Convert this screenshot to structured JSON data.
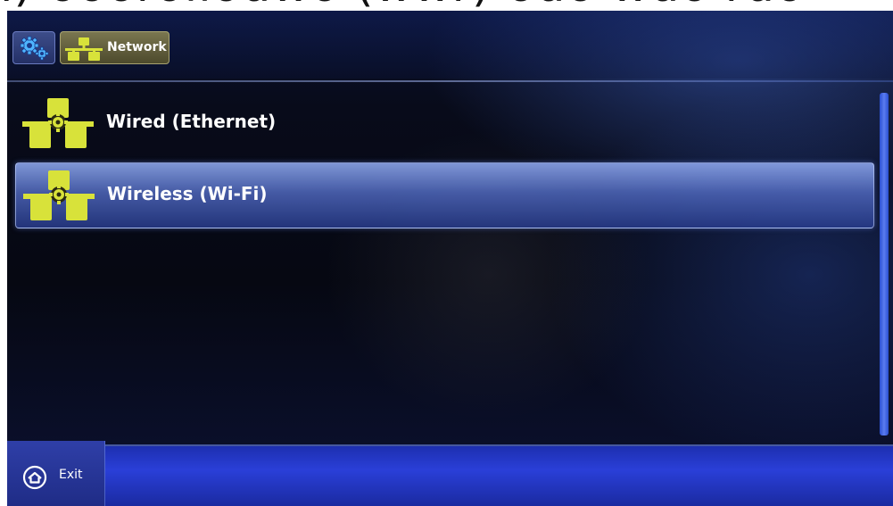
{
  "top_strip": {
    "text": "ı) ooorollouwo (wwr) ouo wuo ruo"
  },
  "header": {
    "settings_icon": "gears-icon",
    "breadcrumb": {
      "icon": "network-icon",
      "label": "Network"
    }
  },
  "list": {
    "items": [
      {
        "label": "Wired (Ethernet)",
        "icon": "network-gear-icon",
        "selected": false
      },
      {
        "label": "Wireless (Wi-Fi)",
        "icon": "network-gear-icon",
        "selected": true
      }
    ]
  },
  "footer": {
    "exit": {
      "icon": "home-icon",
      "label": "Exit"
    }
  },
  "colors": {
    "icon_yellow": "#d8e23a",
    "selection_blue": "#5a78d0",
    "scrollbar_blue": "#3b5ee0",
    "footer_blue": "#2438c4"
  }
}
